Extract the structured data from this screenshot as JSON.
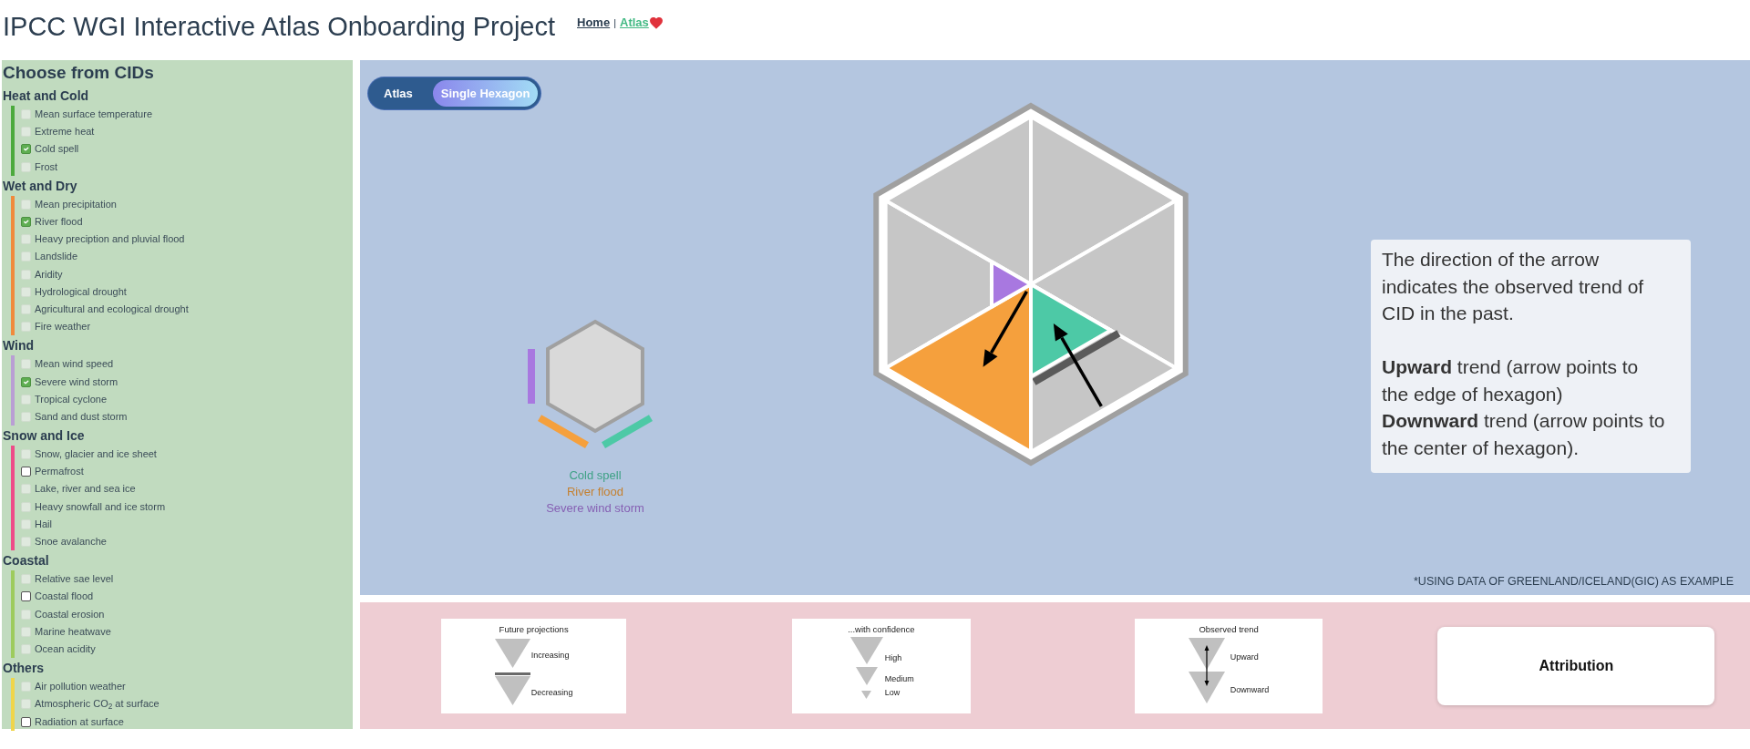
{
  "header": {
    "title": "IPCC WGI Interactive Atlas Onboarding Project",
    "separator": "|",
    "links": [
      {
        "label": "Home",
        "selected": false,
        "icon": false
      },
      {
        "label": "Atlas",
        "selected": true,
        "icon": true
      }
    ]
  },
  "sidebar": {
    "title": "Choose from CIDs",
    "groups": [
      {
        "name": "Heat and Cold",
        "color": "#4caa3d",
        "items": [
          {
            "label": "Mean surface temperature",
            "checked": false,
            "disabled": true
          },
          {
            "label": "Extreme heat",
            "checked": false,
            "disabled": true
          },
          {
            "label": "Cold spell",
            "checked": true,
            "disabled": false
          },
          {
            "label": "Frost",
            "checked": false,
            "disabled": true
          }
        ]
      },
      {
        "name": "Wet and Dry",
        "color": "#f08a3c",
        "items": [
          {
            "label": "Mean precipitation",
            "checked": false,
            "disabled": true
          },
          {
            "label": "River flood",
            "checked": true,
            "disabled": false
          },
          {
            "label": "Heavy preciption and pluvial flood",
            "checked": false,
            "disabled": true
          },
          {
            "label": "Landslide",
            "checked": false,
            "disabled": true
          },
          {
            "label": "Aridity",
            "checked": false,
            "disabled": true
          },
          {
            "label": "Hydrological drought",
            "checked": false,
            "disabled": true
          },
          {
            "label": "Agricultural and ecological drought",
            "checked": false,
            "disabled": true
          },
          {
            "label": "Fire weather",
            "checked": false,
            "disabled": true
          }
        ]
      },
      {
        "name": "Wind",
        "color": "#b99ed4",
        "items": [
          {
            "label": "Mean wind speed",
            "checked": false,
            "disabled": true
          },
          {
            "label": "Severe wind storm",
            "checked": true,
            "disabled": false
          },
          {
            "label": "Tropical cyclone",
            "checked": false,
            "disabled": true
          },
          {
            "label": "Sand and dust storm",
            "checked": false,
            "disabled": true
          }
        ]
      },
      {
        "name": "Snow and Ice",
        "color": "#ee4c88",
        "items": [
          {
            "label": "Snow, glacier and ice sheet",
            "checked": false,
            "disabled": true
          },
          {
            "label": "Permafrost",
            "checked": false,
            "disabled": false
          },
          {
            "label": "Lake, river and sea ice",
            "checked": false,
            "disabled": true
          },
          {
            "label": "Heavy snowfall and ice storm",
            "checked": false,
            "disabled": true
          },
          {
            "label": "Hail",
            "checked": false,
            "disabled": true
          },
          {
            "label": "Snoe avalanche",
            "checked": false,
            "disabled": true
          }
        ]
      },
      {
        "name": "Coastal",
        "color": "#9dcb5d",
        "items": [
          {
            "label": "Relative sae level",
            "checked": false,
            "disabled": true
          },
          {
            "label": "Coastal flood",
            "checked": false,
            "disabled": false
          },
          {
            "label": "Coastal erosion",
            "checked": false,
            "disabled": true
          },
          {
            "label": "Marine heatwave",
            "checked": false,
            "disabled": true
          },
          {
            "label": "Ocean acidity",
            "checked": false,
            "disabled": true
          }
        ]
      },
      {
        "name": "Others",
        "color": "#efd54b",
        "items": [
          {
            "label": "Air pollution weather",
            "checked": false,
            "disabled": true
          },
          {
            "label": "Atmospheric CO$_{2}$ at surface",
            "checked": false,
            "disabled": true
          },
          {
            "label": "Radiation at surface",
            "checked": false,
            "disabled": false
          }
        ]
      }
    ]
  },
  "view_switch": [
    {
      "label": "Atlas",
      "selected": false
    },
    {
      "label": "Single Hexagon",
      "selected": true
    }
  ],
  "single_hexagon": {
    "sectors": [
      {
        "filled": false
      },
      {
        "filled": false
      },
      {
        "filled": true,
        "label": "Cold spell",
        "color": "#4dc9a6",
        "kind": "medium",
        "decreasing": true,
        "trend_up": false,
        "trend_down": true
      },
      {
        "filled": true,
        "label": "River flood",
        "color": "#f5a03d",
        "kind": "high",
        "decreasing": false,
        "trend_up": true,
        "trend_down": false
      },
      {
        "filled": true,
        "label": "Severe wind storm",
        "color": "#a878e0",
        "kind": "low",
        "decreasing": false,
        "trend_up": false,
        "trend_down": false
      },
      {
        "filled": false
      }
    ],
    "explanation": {
      "intro": "The direction of the arrow indicates the observed trend of CID in the past.",
      "lines": [
        "**Upward** trend (arrow points to the edge of hexagon)",
        "**Downward** trend (arrow points to the center of hexagon)."
      ]
    },
    "footnote": "*USING DATA OF GREENLAND/ICELAND(GIC) AS EXAMPLE"
  },
  "legend": [
    {
      "kind": "projection",
      "title": "Future projections",
      "entries": [
        {
          "label": "Increasing",
          "kind": "plain"
        },
        {
          "label": "Decreasing",
          "kind": "barred"
        }
      ]
    },
    {
      "kind": "confidence",
      "title": "...with confidence",
      "entries": [
        {
          "label": "High",
          "kind": "large"
        },
        {
          "label": "Medium",
          "kind": "medium"
        },
        {
          "label": "Low",
          "kind": "small"
        }
      ]
    },
    {
      "kind": "trend",
      "title": "Observed trend",
      "entries": [
        {
          "label": "Upward"
        },
        {
          "label": "Downward"
        }
      ]
    },
    {
      "kind": "button",
      "label": "Attribution"
    }
  ]
}
